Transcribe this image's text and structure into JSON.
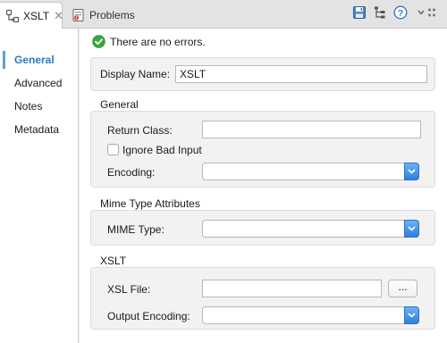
{
  "tabs": [
    {
      "label": "XSLT",
      "icon": "xslt-transform-icon",
      "active": true
    },
    {
      "label": "Problems",
      "icon": "problems-icon",
      "active": false
    }
  ],
  "toolbar": {
    "icons": [
      "save-icon",
      "hierarchy-icon",
      "help-icon"
    ],
    "view_menu_icon": "chevron-down-icon"
  },
  "nav": {
    "items": [
      {
        "label": "General",
        "selected": true
      },
      {
        "label": "Advanced",
        "selected": false
      },
      {
        "label": "Notes",
        "selected": false
      },
      {
        "label": "Metadata",
        "selected": false
      }
    ]
  },
  "status": {
    "text": "There are no errors.",
    "icon": "check-circle-icon"
  },
  "display_name": {
    "label": "Display Name:",
    "value": "XSLT"
  },
  "general": {
    "title": "General",
    "return_class_label": "Return Class:",
    "return_class_value": "",
    "ignore_bad_input_label": "Ignore Bad Input",
    "ignore_bad_input_checked": false,
    "encoding_label": "Encoding:",
    "encoding_value": ""
  },
  "mime": {
    "title": "Mime Type Attributes",
    "mime_type_label": "MIME Type:",
    "mime_type_value": ""
  },
  "xslt": {
    "title": "XSLT",
    "xsl_file_label": "XSL File:",
    "xsl_file_value": "",
    "browse_label": "...",
    "output_encoding_label": "Output Encoding:",
    "output_encoding_value": ""
  },
  "colors": {
    "accent": "#2b79c8",
    "combo_button": "#3f8ee8",
    "ok_green": "#3aa83a"
  }
}
